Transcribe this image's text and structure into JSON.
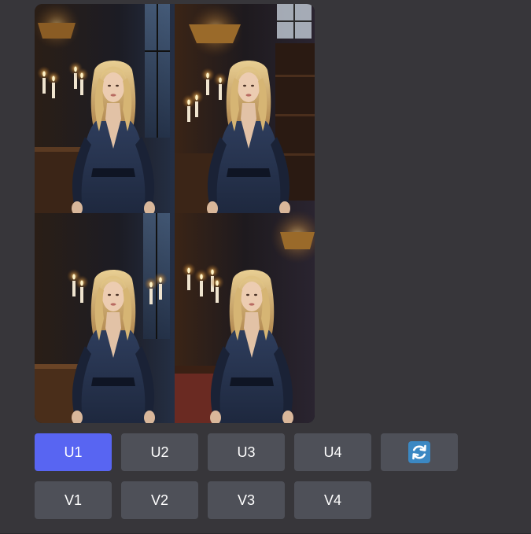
{
  "upscale_buttons": [
    "U1",
    "U2",
    "U3",
    "U4"
  ],
  "variation_buttons": [
    "V1",
    "V2",
    "V3",
    "V4"
  ],
  "reroll": {
    "icon": "refresh-icon"
  },
  "colors": {
    "background": "#37363a",
    "button": "#4e5058",
    "button_primary": "#5865f2",
    "reroll_icon_bg": "#3b88c3",
    "button_text": "#ffffff"
  }
}
